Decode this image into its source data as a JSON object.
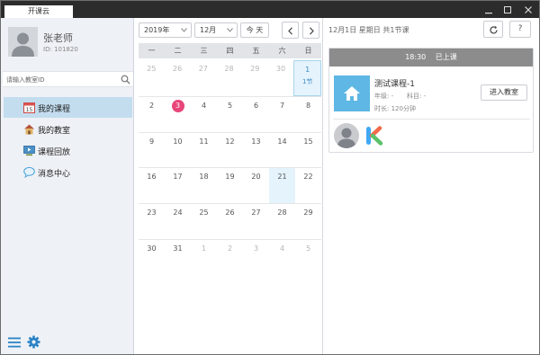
{
  "window": {
    "tab_title": "开课云",
    "controls": [
      "minimize-icon",
      "maximize-icon",
      "close-icon"
    ]
  },
  "profile": {
    "name": "张老师",
    "id_label": "ID:",
    "id_value": "101820"
  },
  "search": {
    "placeholder": "请输入教室ID"
  },
  "nav": [
    {
      "label": "我的课程",
      "icon": "calendar-icon",
      "active": true
    },
    {
      "label": "我的教室",
      "icon": "house-icon",
      "active": false
    },
    {
      "label": "课程回放",
      "icon": "playback-icon",
      "active": false
    },
    {
      "label": "消息中心",
      "icon": "chat-bubble-icon",
      "active": false
    }
  ],
  "bottom_bar": {
    "icons": [
      "menu-icon",
      "gear-icon"
    ]
  },
  "calendar": {
    "year": "2019年",
    "month": "12月",
    "today_label": "今 天",
    "weekdays": [
      "一",
      "二",
      "三",
      "四",
      "五",
      "六",
      "日"
    ],
    "weeks": [
      [
        "25",
        "26",
        "27",
        "28",
        "29",
        "30",
        "1"
      ],
      [
        "2",
        "3",
        "4",
        "5",
        "6",
        "7",
        "8"
      ],
      [
        "9",
        "10",
        "11",
        "12",
        "13",
        "14",
        "15"
      ],
      [
        "16",
        "17",
        "18",
        "19",
        "20",
        "21",
        "22"
      ],
      [
        "23",
        "24",
        "25",
        "26",
        "27",
        "28",
        "29"
      ],
      [
        "30",
        "31",
        "1",
        "2",
        "3",
        "4",
        "5"
      ]
    ],
    "course_count_label": "1节",
    "accent": "#e8457a",
    "selected_bg": "#e5f3fc"
  },
  "detail": {
    "date_summary": "12月1日 星期日 共1节课",
    "help_label": "?",
    "card": {
      "time": "18:30",
      "status": "已上课",
      "title": "测试课程-1",
      "grade_label": "年级: -",
      "subject_label": "科目: -",
      "duration_label": "时长: 120分钟",
      "enter_button": "进入教室"
    }
  }
}
